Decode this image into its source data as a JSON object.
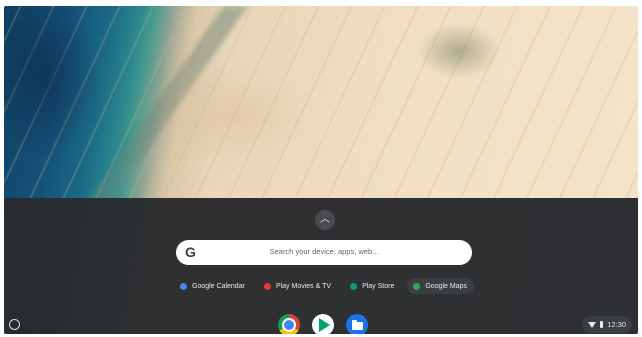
{
  "launcher": {
    "expand_glyph": "︿",
    "search": {
      "logo": "G",
      "placeholder": "Search your device, apps, web..."
    },
    "suggestions": [
      {
        "label": "Google Calendar",
        "icon": "calendar-icon",
        "color": "#4285f4"
      },
      {
        "label": "Play Movies & TV",
        "icon": "play-movies-icon",
        "color": "#e53935"
      },
      {
        "label": "Play Store",
        "icon": "play-store-icon",
        "color": "#00a173"
      },
      {
        "label": "Google Maps",
        "icon": "maps-icon",
        "color": "#34a853"
      }
    ]
  },
  "shelf": {
    "apps": [
      {
        "name": "Chrome",
        "icon": "chrome-icon"
      },
      {
        "name": "Play Store",
        "icon": "play-store-icon"
      },
      {
        "name": "Files",
        "icon": "files-icon"
      }
    ],
    "status": {
      "time": "12:30",
      "wifi_icon": "wifi-icon",
      "battery_icon": "battery-icon"
    }
  }
}
